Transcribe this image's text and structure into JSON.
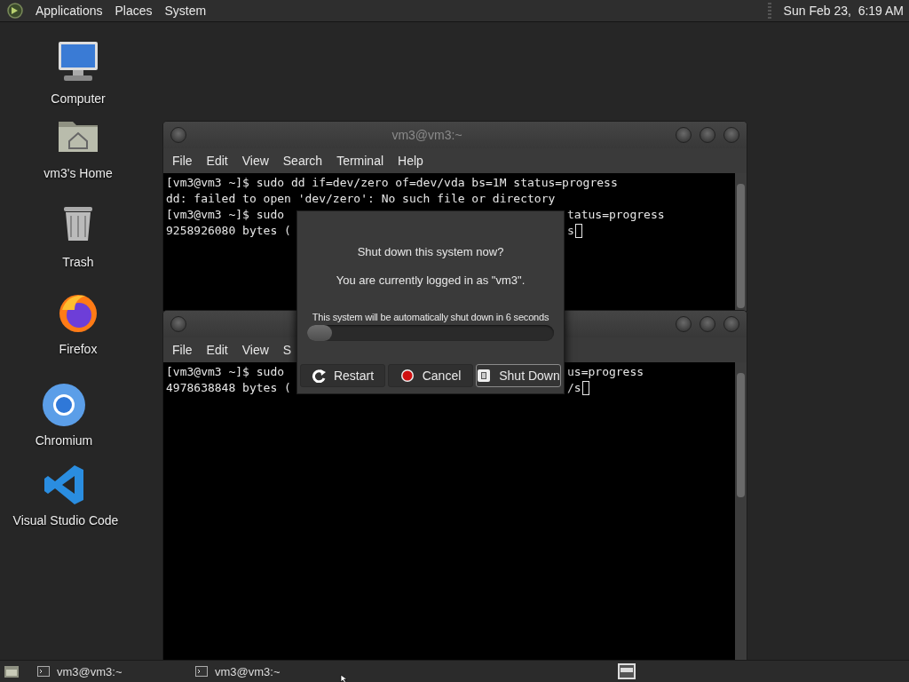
{
  "top_panel": {
    "menus": [
      "Applications",
      "Places",
      "System"
    ],
    "clock": "Sun Feb 23,  6:19 AM"
  },
  "desktop_icons": [
    {
      "label": "Computer",
      "kind": "computer"
    },
    {
      "label": "vm3's Home",
      "kind": "home"
    },
    {
      "label": "Trash",
      "kind": "trash"
    },
    {
      "label": "Firefox",
      "kind": "firefox"
    },
    {
      "label": "Chromium",
      "kind": "chromium"
    },
    {
      "label": "Visual Studio Code",
      "kind": "vscode"
    }
  ],
  "windows": [
    {
      "title": "vm3@vm3:~",
      "menu": [
        "File",
        "Edit",
        "View",
        "Search",
        "Terminal",
        "Help"
      ],
      "lines": [
        {
          "text": "[vm3@vm3 ~]$ sudo dd if=dev/zero of=dev/vda bs=1M status=progress",
          "cursor": false
        },
        {
          "text": "dd: failed to open 'dev/zero': No such file or directory",
          "cursor": false
        },
        {
          "text": "[vm3@vm3 ~]$ sudo",
          "tail": "tatus=progress",
          "cursor": false
        },
        {
          "text": "9258926080 bytes (",
          "tail": "s",
          "cursor": true
        }
      ]
    },
    {
      "menu": [
        "File",
        "Edit",
        "View",
        "S"
      ],
      "lines": [
        {
          "text": "[vm3@vm3 ~]$ sudo",
          "tail": "us=progress",
          "cursor": false
        },
        {
          "text": "4978638848 bytes (",
          "tail": "/s",
          "cursor": true
        }
      ]
    }
  ],
  "dialog": {
    "question": "Shut down this system now?",
    "info": "You are currently logged in as \"vm3\".",
    "countdown": "This system will be automatically shut down in 6 seconds",
    "level": 0.1,
    "buttons": [
      {
        "label": "Restart",
        "kind": "restart",
        "focused": false
      },
      {
        "label": "Cancel",
        "kind": "cancel",
        "focused": false
      },
      {
        "label": "Shut Down",
        "kind": "shutdown",
        "focused": true
      }
    ]
  },
  "taskbar": {
    "tasks": [
      {
        "label": "vm3@vm3:~"
      },
      {
        "label": "vm3@vm3:~"
      }
    ]
  }
}
